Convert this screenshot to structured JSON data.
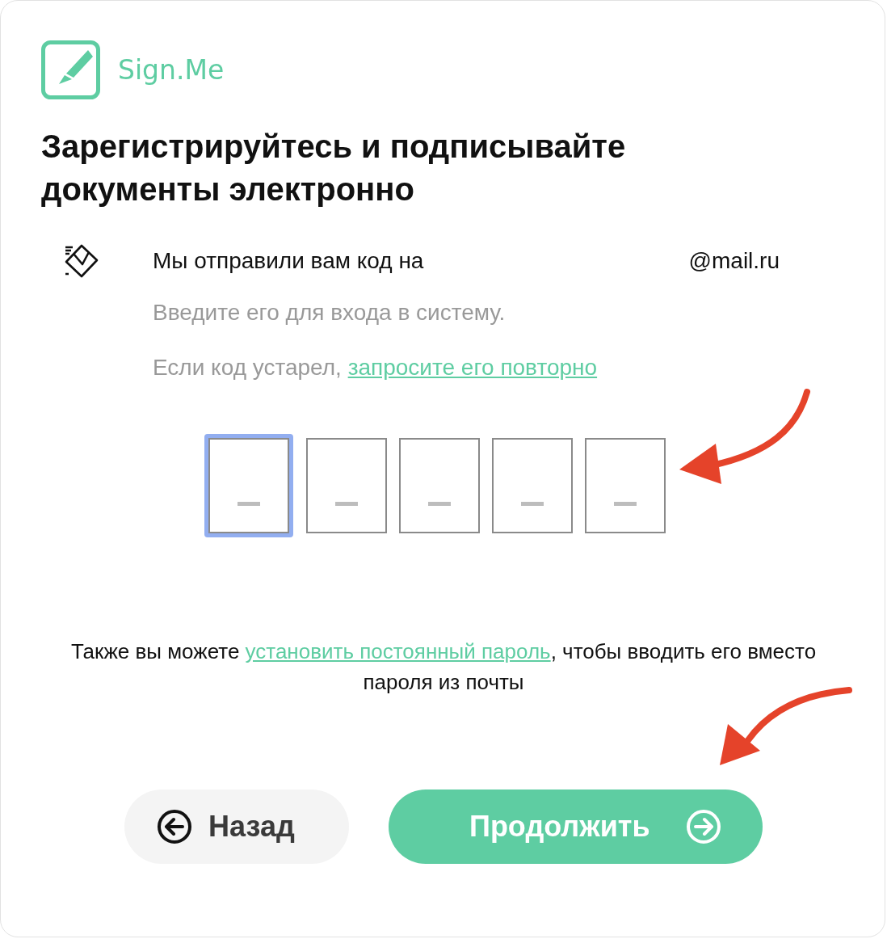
{
  "logo": {
    "name": "Sign.Me"
  },
  "title": "Зарегистрируйтесь и подписывайте документы электронно",
  "notice": {
    "sent_text": "Мы отправили вам код на",
    "email": "@mail.ru",
    "hint": "Введите его для входа в систему.",
    "resend_prefix": "Если код устарел,",
    "resend_link": "запросите его повторно"
  },
  "code_boxes": [
    {
      "selected": true
    },
    {
      "selected": false
    },
    {
      "selected": false
    },
    {
      "selected": false
    },
    {
      "selected": false
    }
  ],
  "password_note": {
    "prefix": "Также вы можете",
    "link": "установить постоянный пароль",
    "suffix": ", чтобы вводить его вместо пароля из почты"
  },
  "buttons": [
    {
      "kind": "back",
      "label": "Назад"
    },
    {
      "kind": "continue",
      "label": "Продолжить"
    }
  ]
}
